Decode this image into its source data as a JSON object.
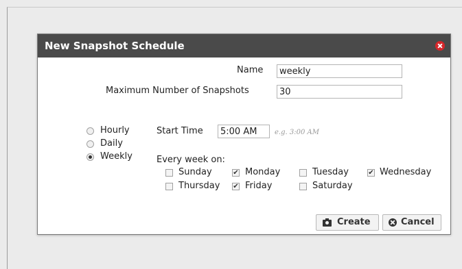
{
  "dialog": {
    "title": "New Snapshot Schedule",
    "close_icon": "close-circle-icon",
    "accent_color": "#d6262a"
  },
  "form": {
    "name_label": "Name",
    "name_value": "weekly",
    "max_label": "Maximum Number of Snapshots",
    "max_value": "30",
    "frequency": {
      "options": [
        "Hourly",
        "Daily",
        "Weekly"
      ],
      "selected": "Weekly"
    },
    "start_time_label": "Start Time",
    "start_time_value": "5:00 AM",
    "start_time_hint": "e.g. 3:00 AM",
    "every_week_label": "Every week on:",
    "days": [
      {
        "label": "Sunday",
        "checked": false
      },
      {
        "label": "Monday",
        "checked": true
      },
      {
        "label": "Tuesday",
        "checked": false
      },
      {
        "label": "Wednesday",
        "checked": true
      },
      {
        "label": "Thursday",
        "checked": false
      },
      {
        "label": "Friday",
        "checked": true
      },
      {
        "label": "Saturday",
        "checked": false
      }
    ]
  },
  "buttons": {
    "create_label": "Create",
    "create_icon": "camera-icon",
    "cancel_label": "Cancel",
    "cancel_icon": "cancel-circle-icon"
  }
}
